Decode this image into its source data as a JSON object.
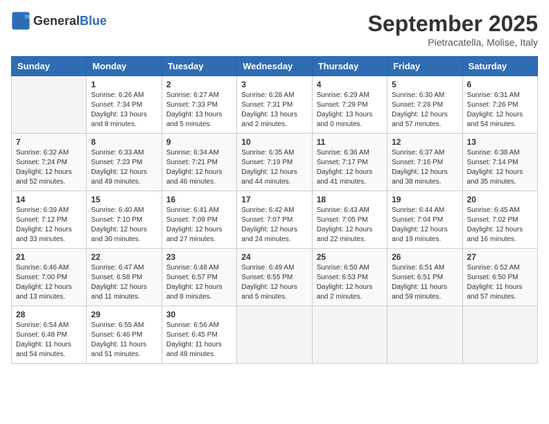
{
  "logo": {
    "general": "General",
    "blue": "Blue"
  },
  "header": {
    "month": "September 2025",
    "location": "Pietracatella, Molise, Italy"
  },
  "weekdays": [
    "Sunday",
    "Monday",
    "Tuesday",
    "Wednesday",
    "Thursday",
    "Friday",
    "Saturday"
  ],
  "weeks": [
    [
      {
        "day": "",
        "info": ""
      },
      {
        "day": "1",
        "info": "Sunrise: 6:26 AM\nSunset: 7:34 PM\nDaylight: 13 hours\nand 8 minutes."
      },
      {
        "day": "2",
        "info": "Sunrise: 6:27 AM\nSunset: 7:33 PM\nDaylight: 13 hours\nand 5 minutes."
      },
      {
        "day": "3",
        "info": "Sunrise: 6:28 AM\nSunset: 7:31 PM\nDaylight: 13 hours\nand 2 minutes."
      },
      {
        "day": "4",
        "info": "Sunrise: 6:29 AM\nSunset: 7:29 PM\nDaylight: 13 hours\nand 0 minutes."
      },
      {
        "day": "5",
        "info": "Sunrise: 6:30 AM\nSunset: 7:28 PM\nDaylight: 12 hours\nand 57 minutes."
      },
      {
        "day": "6",
        "info": "Sunrise: 6:31 AM\nSunset: 7:26 PM\nDaylight: 12 hours\nand 54 minutes."
      }
    ],
    [
      {
        "day": "7",
        "info": "Sunrise: 6:32 AM\nSunset: 7:24 PM\nDaylight: 12 hours\nand 52 minutes."
      },
      {
        "day": "8",
        "info": "Sunrise: 6:33 AM\nSunset: 7:23 PM\nDaylight: 12 hours\nand 49 minutes."
      },
      {
        "day": "9",
        "info": "Sunrise: 6:34 AM\nSunset: 7:21 PM\nDaylight: 12 hours\nand 46 minutes."
      },
      {
        "day": "10",
        "info": "Sunrise: 6:35 AM\nSunset: 7:19 PM\nDaylight: 12 hours\nand 44 minutes."
      },
      {
        "day": "11",
        "info": "Sunrise: 6:36 AM\nSunset: 7:17 PM\nDaylight: 12 hours\nand 41 minutes."
      },
      {
        "day": "12",
        "info": "Sunrise: 6:37 AM\nSunset: 7:16 PM\nDaylight: 12 hours\nand 38 minutes."
      },
      {
        "day": "13",
        "info": "Sunrise: 6:38 AM\nSunset: 7:14 PM\nDaylight: 12 hours\nand 35 minutes."
      }
    ],
    [
      {
        "day": "14",
        "info": "Sunrise: 6:39 AM\nSunset: 7:12 PM\nDaylight: 12 hours\nand 33 minutes."
      },
      {
        "day": "15",
        "info": "Sunrise: 6:40 AM\nSunset: 7:10 PM\nDaylight: 12 hours\nand 30 minutes."
      },
      {
        "day": "16",
        "info": "Sunrise: 6:41 AM\nSunset: 7:09 PM\nDaylight: 12 hours\nand 27 minutes."
      },
      {
        "day": "17",
        "info": "Sunrise: 6:42 AM\nSunset: 7:07 PM\nDaylight: 12 hours\nand 24 minutes."
      },
      {
        "day": "18",
        "info": "Sunrise: 6:43 AM\nSunset: 7:05 PM\nDaylight: 12 hours\nand 22 minutes."
      },
      {
        "day": "19",
        "info": "Sunrise: 6:44 AM\nSunset: 7:04 PM\nDaylight: 12 hours\nand 19 minutes."
      },
      {
        "day": "20",
        "info": "Sunrise: 6:45 AM\nSunset: 7:02 PM\nDaylight: 12 hours\nand 16 minutes."
      }
    ],
    [
      {
        "day": "21",
        "info": "Sunrise: 6:46 AM\nSunset: 7:00 PM\nDaylight: 12 hours\nand 13 minutes."
      },
      {
        "day": "22",
        "info": "Sunrise: 6:47 AM\nSunset: 6:58 PM\nDaylight: 12 hours\nand 11 minutes."
      },
      {
        "day": "23",
        "info": "Sunrise: 6:48 AM\nSunset: 6:57 PM\nDaylight: 12 hours\nand 8 minutes."
      },
      {
        "day": "24",
        "info": "Sunrise: 6:49 AM\nSunset: 6:55 PM\nDaylight: 12 hours\nand 5 minutes."
      },
      {
        "day": "25",
        "info": "Sunrise: 6:50 AM\nSunset: 6:53 PM\nDaylight: 12 hours\nand 2 minutes."
      },
      {
        "day": "26",
        "info": "Sunrise: 6:51 AM\nSunset: 6:51 PM\nDaylight: 11 hours\nand 59 minutes."
      },
      {
        "day": "27",
        "info": "Sunrise: 6:52 AM\nSunset: 6:50 PM\nDaylight: 11 hours\nand 57 minutes."
      }
    ],
    [
      {
        "day": "28",
        "info": "Sunrise: 6:54 AM\nSunset: 6:48 PM\nDaylight: 11 hours\nand 54 minutes."
      },
      {
        "day": "29",
        "info": "Sunrise: 6:55 AM\nSunset: 6:46 PM\nDaylight: 11 hours\nand 51 minutes."
      },
      {
        "day": "30",
        "info": "Sunrise: 6:56 AM\nSunset: 6:45 PM\nDaylight: 11 hours\nand 48 minutes."
      },
      {
        "day": "",
        "info": ""
      },
      {
        "day": "",
        "info": ""
      },
      {
        "day": "",
        "info": ""
      },
      {
        "day": "",
        "info": ""
      }
    ]
  ]
}
